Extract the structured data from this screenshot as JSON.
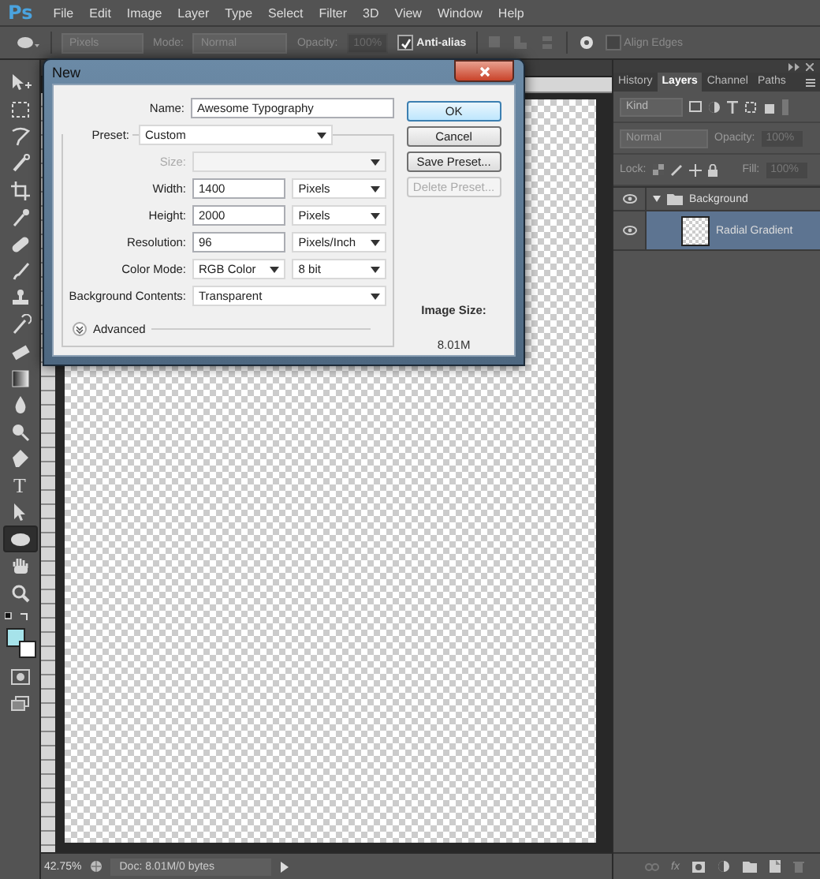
{
  "logo": "Ps",
  "menu": [
    "File",
    "Edit",
    "Image",
    "Layer",
    "Type",
    "Select",
    "Filter",
    "3D",
    "View",
    "Window",
    "Help"
  ],
  "options": {
    "units": "Pixels",
    "mode_label": "Mode:",
    "mode": "Normal",
    "opacity_label": "Opacity:",
    "opacity": "100%",
    "anti_alias": {
      "label": "Anti-alias",
      "checked": true
    },
    "align_edges": {
      "label": "Align Edges",
      "checked": false
    }
  },
  "tools": [
    {
      "kind": "move",
      "selected": false
    },
    {
      "kind": "marquee",
      "selected": false
    },
    {
      "kind": "lasso",
      "selected": false
    },
    {
      "kind": "quick_select",
      "selected": false
    },
    {
      "kind": "crop",
      "selected": false
    },
    {
      "kind": "eyedropper",
      "selected": false
    },
    {
      "kind": "healing",
      "selected": false
    },
    {
      "kind": "brush",
      "selected": false
    },
    {
      "kind": "stamp",
      "selected": false
    },
    {
      "kind": "history_brush",
      "selected": false
    },
    {
      "kind": "eraser",
      "selected": false
    },
    {
      "kind": "gradient",
      "selected": false
    },
    {
      "kind": "blur",
      "selected": false
    },
    {
      "kind": "dodge",
      "selected": false
    },
    {
      "kind": "pen",
      "selected": false
    },
    {
      "kind": "type",
      "glyph": "T",
      "selected": false
    },
    {
      "kind": "path_select",
      "selected": false
    },
    {
      "kind": "ellipse",
      "selected": true
    },
    {
      "kind": "hand",
      "selected": false
    },
    {
      "kind": "zoom",
      "selected": false
    }
  ],
  "swatches": [
    {
      "kind": "foreground",
      "color": "#a6e3ea"
    },
    {
      "kind": "background",
      "color": "#ffffff"
    }
  ],
  "dialog": {
    "title": "New",
    "name": {
      "label": "Name:",
      "value": "Awesome Typography"
    },
    "preset": {
      "label": "Preset:",
      "value": "Custom"
    },
    "fields": [
      {
        "kind": "select",
        "label": "Size:",
        "disabled": true
      },
      {
        "kind": "number_unit",
        "label": "Width:",
        "value": "1400",
        "unit": "Pixels"
      },
      {
        "kind": "number_unit",
        "label": "Height:",
        "value": "2000",
        "unit": "Pixels"
      },
      {
        "kind": "number_unit",
        "label": "Resolution:",
        "value": "96",
        "unit": "Pixels/Inch"
      },
      {
        "kind": "select_pair",
        "label": "Color Mode:",
        "value": "RGB Color",
        "unit": "8 bit"
      },
      {
        "kind": "select",
        "label": "Background Contents:",
        "value": "Transparent",
        "disabled": false
      }
    ],
    "advanced": {
      "label": "Advanced",
      "expanded": false
    },
    "buttons": [
      {
        "label": "OK",
        "default": true,
        "disabled": false
      },
      {
        "label": "Cancel",
        "default": false,
        "disabled": false
      },
      {
        "label": "Save Preset...",
        "default": false,
        "disabled": false
      },
      {
        "label": "Delete Preset...",
        "default": false,
        "disabled": true
      }
    ],
    "image_size_label": "Image Size:",
    "image_size": "8.01M"
  },
  "layers_panel": {
    "tabs": [
      {
        "label": "History",
        "selected": false
      },
      {
        "label": "Layers",
        "selected": true
      },
      {
        "label": "Channel",
        "selected": false
      },
      {
        "label": "Paths",
        "selected": false
      }
    ],
    "filter": "Kind",
    "blend_mode": "Normal",
    "opacity_label": "Opacity:",
    "opacity": "100%",
    "lock_label": "Lock:",
    "fill_label": "Fill:",
    "fill": "100%",
    "fx": "fx",
    "layers": [
      {
        "kind": "group",
        "name": "Background",
        "visible": true,
        "expanded": true,
        "selected": false,
        "children": [
          {
            "kind": "layer",
            "name": "Radial Gradient",
            "visible": true,
            "selected": true
          }
        ]
      }
    ]
  },
  "status": {
    "zoom": "42.75%",
    "doc": "Doc: 8.01M/0 bytes"
  }
}
